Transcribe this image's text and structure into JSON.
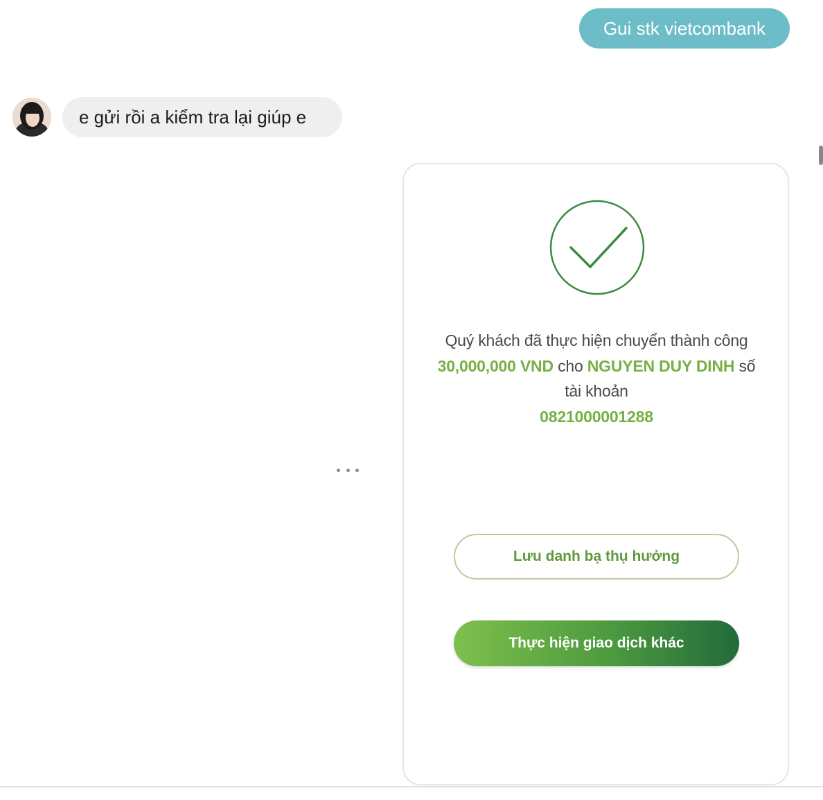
{
  "chat": {
    "sent_message": "Gui stk vietcombank",
    "received_message": "e gửi rồi a kiểm tra lại giúp e"
  },
  "image": {
    "msg_before_amount": "Quý khách đã thực hiện chuyển thành công ",
    "amount": "30,000,000 VND",
    "msg_before_name": " cho ",
    "recipient_name": "NGUYEN DUY DINH",
    "msg_before_account": " số tài khoản ",
    "account_number": "0821000001288",
    "save_contact_button": "Lưu danh bạ thụ hưởng",
    "new_transaction_button": "Thực hiện giao dịch khác"
  },
  "colors": {
    "sent_bubble": "#6cbdc7",
    "received_bubble": "#efefef",
    "highlight_green": "#76b043",
    "check_green": "#3b8a3e"
  },
  "icons": {
    "check": "check-circle-icon",
    "more": "more-horizontal-icon"
  }
}
